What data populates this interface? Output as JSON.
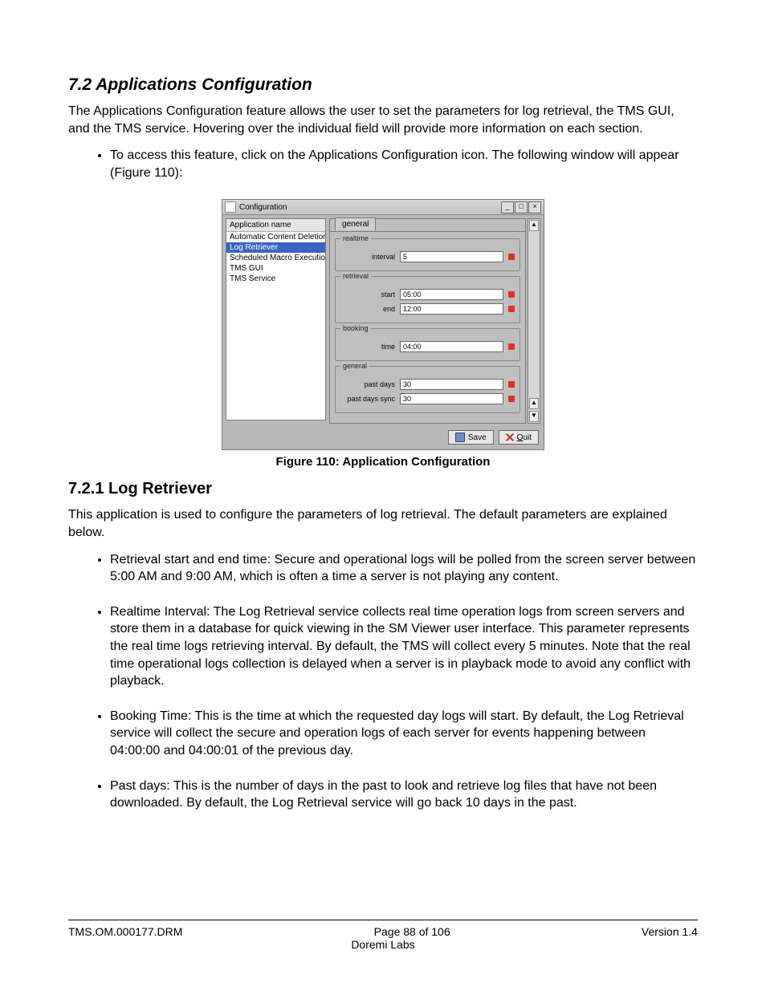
{
  "h_72": "7.2  Applications Configuration",
  "p_intro": "The Applications Configuration feature allows the user to set the parameters for log retrieval, the TMS GUI, and the TMS service. Hovering over the individual field will provide more information on each section.",
  "intro_bullet": "To access this feature, click on the Applications Configuration icon. The following window will appear (Figure 110):",
  "figure_caption": "Figure 110: Application Configuration",
  "h_721": "7.2.1  Log Retriever",
  "p_721": "This application is used to configure the parameters of log retrieval. The default parameters are explained below.",
  "bullets_721": [
    "Retrieval start and end time: Secure and operational logs will be polled from the screen server between 5:00 AM and 9:00 AM, which is often a time a server is not playing any content.",
    "Realtime Interval: The Log Retrieval service collects real time operation logs from screen servers and store them in a database for quick viewing in the SM Viewer user interface. This parameter represents the real time logs retrieving interval. By default, the TMS will collect every 5 minutes. Note that the real time operational logs collection is delayed when a server is in playback mode to avoid any conflict with playback.",
    "Booking Time: This is the time at which the requested day logs will start. By default, the Log Retrieval service will collect the secure and operation logs of each server for events happening between 04:00:00 and 04:00:01 of the previous day.",
    "Past days: This is the number of days in the past to look and retrieve log files that have not been downloaded. By default, the Log Retrieval service will go back 10 days in the past."
  ],
  "config_window": {
    "title": "Configuration",
    "side_header": "Application name",
    "side_items": [
      "Automatic Content Deletion",
      "Log Retriever",
      "Scheduled Macro Execution",
      "TMS GUI",
      "TMS Service"
    ],
    "side_active_index": 1,
    "tab": "general",
    "groups": {
      "realtime": {
        "legend": "realtime",
        "fields": [
          {
            "label": "interval",
            "value": "5"
          }
        ]
      },
      "retrieval": {
        "legend": "retrieval",
        "fields": [
          {
            "label": "start",
            "value": "05:00"
          },
          {
            "label": "end",
            "value": "12:00"
          }
        ]
      },
      "booking": {
        "legend": "booking",
        "fields": [
          {
            "label": "time",
            "value": "04:00"
          }
        ]
      },
      "general": {
        "legend": "general",
        "fields": [
          {
            "label": "past days",
            "value": "30"
          },
          {
            "label": "past days sync",
            "value": "30"
          }
        ]
      }
    },
    "buttons": {
      "save": "Save",
      "quit": "Quit",
      "quit_key": "Q"
    }
  },
  "footer": {
    "left": "TMS.OM.000177.DRM",
    "center_top": "Page 88 of 106",
    "center_bottom": "Doremi Labs",
    "right": "Version 1.4"
  }
}
